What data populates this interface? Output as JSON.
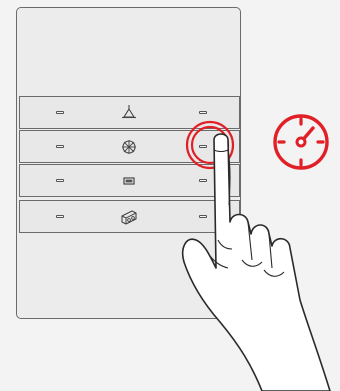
{
  "panel": {
    "rows": [
      {
        "icon": "ceiling-lamp-icon",
        "left_led": "off",
        "right_led": "off",
        "pressed": false
      },
      {
        "icon": "sun-light-icon",
        "left_led": "off",
        "right_led": "on",
        "pressed": true
      },
      {
        "icon": "blind-icon",
        "left_led": "off",
        "right_led": "off",
        "pressed": false
      },
      {
        "icon": "projector-icon",
        "left_led": "off",
        "right_led": "off",
        "pressed": false
      }
    ]
  },
  "feature_icon": {
    "name": "speedometer-icon",
    "color": "#e11f26"
  },
  "accent_color": "#e11f26"
}
